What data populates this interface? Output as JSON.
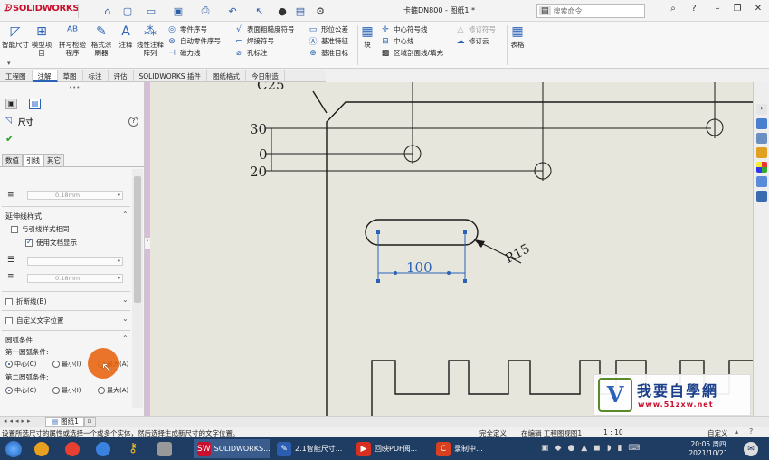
{
  "app": {
    "logo": "SOLIDWORKS",
    "title": "卡箍DN800 - 图纸1 *",
    "search_placeholder": "搜索命令"
  },
  "ribbon": {
    "smart_dim": "智能尺寸",
    "model_items": "模型项目",
    "spell": "拼写检验程序",
    "format_painter": "格式涂刷器",
    "note": "注释",
    "linear_pattern": "线性注释阵列",
    "col1": [
      "零件序号",
      "自动零件序号",
      "磁力线"
    ],
    "col2": [
      "表面粗糙度符号",
      "焊接符号",
      "孔标注"
    ],
    "col3": [
      "形位公差",
      "基准特征",
      "基准目标"
    ],
    "block": "块",
    "col4": [
      "中心符号线",
      "中心线",
      "区域剖面线/填充"
    ],
    "col5": [
      "修订符号",
      "修订云"
    ],
    "table": "表格"
  },
  "tabs": [
    "工程图",
    "注解",
    "草图",
    "标注",
    "评估",
    "SOLIDWORKS 插件",
    "图纸格式",
    "今日制造"
  ],
  "panel": {
    "title": "尺寸",
    "help": "?",
    "subtabs": [
      "数值",
      "引线",
      "其它"
    ],
    "line_thickness": "0.18mm",
    "ext_line_style_title": "延伸线样式",
    "same_as_leader": "与引线样式相同",
    "use_doc_display": "使用文档显示",
    "break_lines": "折断线(B)",
    "custom_text_pos": "自定义文字位置",
    "arc_condition": "圆弧条件",
    "first_arc": "第一圆弧条件:",
    "second_arc": "第二圆弧条件:",
    "arc_options": [
      "中心(C)",
      "最小(I)",
      "最大(A)"
    ]
  },
  "drawing": {
    "top_label": "C25",
    "dim30": "30",
    "dim0": "0",
    "dim20": "20",
    "dim100": "100",
    "radius": "R15"
  },
  "watermark": {
    "text": "我要自學網",
    "url": "www.51zxw.net"
  },
  "sheet_tab": "图纸1",
  "status": {
    "hint": "设置所选尺寸的属性或选择一个或多个实体，然后选择生成新尺寸的文字位置。",
    "defined": "完全定义",
    "editing": "在编辑 工程图视图1",
    "scale": "1 : 10",
    "custom": "自定义"
  },
  "taskbar": {
    "items": [
      "SOLIDWORKS...",
      "2.1智能尺寸...",
      "回映PDF阅...",
      "录制中..."
    ],
    "time": "20:05 周四",
    "date": "2021/10/21"
  },
  "colors": {
    "accent": "#2a62b8",
    "canvas": "#e7e6dd",
    "cursor": "#e8620c",
    "taskbar": "#1f3c63"
  }
}
